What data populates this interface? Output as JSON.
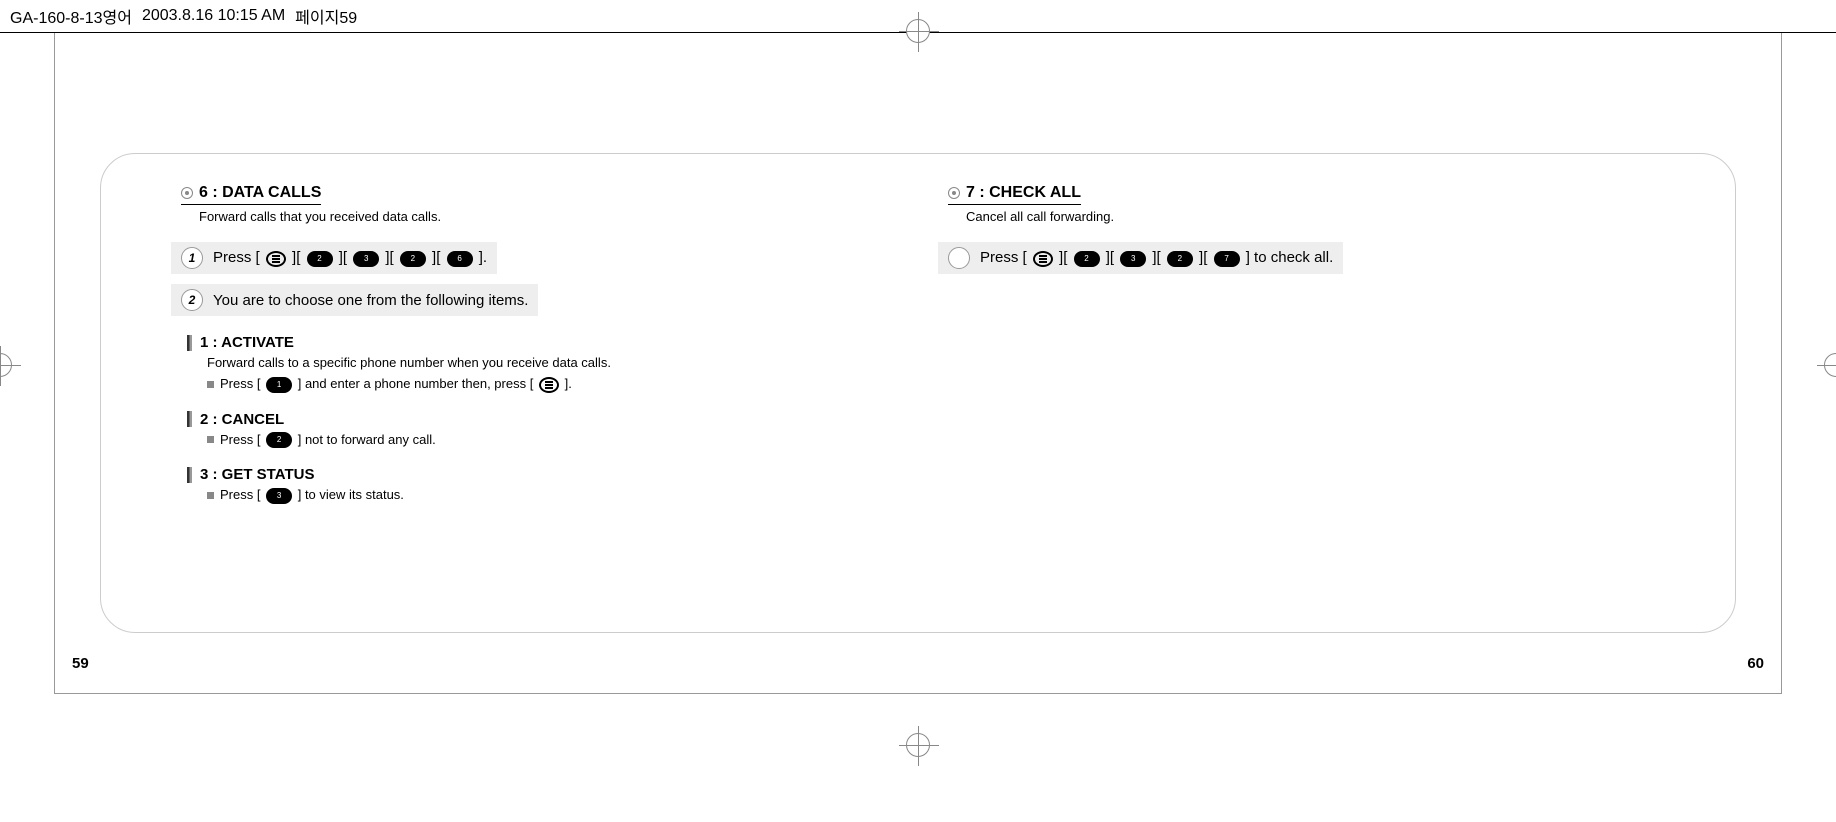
{
  "header": {
    "filename": "GA-160-8-13영어",
    "timestamp": "2003.8.16 10:15 AM",
    "page_label": "페이지59"
  },
  "left": {
    "section_title": "6 : DATA CALLS",
    "subtitle": "Forward calls that you received data calls.",
    "step1_prefix": "Press [",
    "step1_suffix": "].",
    "step1_keys": [
      "MENU",
      "2",
      "3",
      "2",
      "6"
    ],
    "step2": "You are to choose one from the following items.",
    "sub1": {
      "title": "1 : ACTIVATE",
      "desc": "Forward calls to a specific phone number when you receive data calls.",
      "bullet_a": "Press [",
      "bullet_b": "] and enter a phone number then, press [",
      "bullet_c": "]."
    },
    "sub2": {
      "title": "2 : CANCEL",
      "bullet_a": "Press [",
      "bullet_b": "] not to forward any call."
    },
    "sub3": {
      "title": "3 : GET STATUS",
      "bullet_a": "Press [",
      "bullet_b": "] to view its status."
    }
  },
  "right": {
    "section_title": "7 : CHECK ALL",
    "subtitle": "Cancel all call forwarding.",
    "step_prefix": "Press [",
    "step_keys": [
      "MENU",
      "2",
      "3",
      "2",
      "7"
    ],
    "step_suffix": "] to check all."
  },
  "pages": {
    "left": "59",
    "right": "60"
  }
}
